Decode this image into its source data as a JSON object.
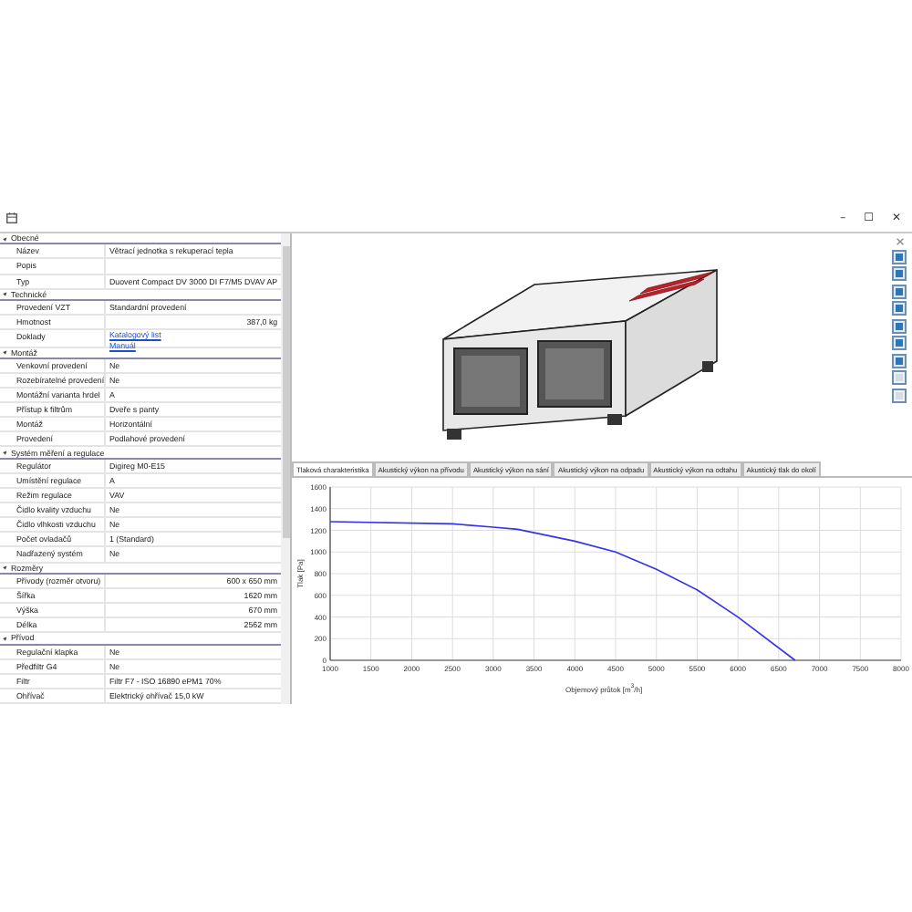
{
  "window": {
    "controls": [
      "–",
      "☐",
      "✕"
    ]
  },
  "properties": [
    {
      "section": "Obecné",
      "expanded": true,
      "rows": [
        {
          "label": "Název",
          "value": "Větrací jednotka s rekuperací tepla"
        },
        {
          "label": "Popis"
        },
        {
          "label": "Typ",
          "value": "Duovent Compact DV 3000 DI F7/M5 DVAV AP"
        }
      ]
    },
    {
      "section": "Technické",
      "expanded": true,
      "rows": [
        {
          "label": "Provedení VZT",
          "value": "Standardní provedení"
        },
        {
          "label": "Hmotnost",
          "value": "387,0 kg",
          "kind": "quantity"
        },
        {
          "label": "Doklady",
          "links": [
            "Katalogový list",
            "Manuál"
          ]
        }
      ]
    },
    {
      "section": "Montáž",
      "expanded": true,
      "rows": [
        {
          "label": "Venkovní provedení",
          "value": "Ne"
        },
        {
          "label": "Rozebíratelné provedení",
          "value": "Ne"
        },
        {
          "label": "Montážní varianta hrdel",
          "value": "A"
        },
        {
          "label": "Přístup k filtrům",
          "value": "Dveře s panty"
        },
        {
          "label": "Montáž",
          "value": "Horizontální"
        },
        {
          "label": "Provedení",
          "value": "Podlahové provedení"
        }
      ]
    },
    {
      "section": "Systém měření a regulace",
      "expanded": true,
      "rows": [
        {
          "label": "Regulátor",
          "value": "Digireg M0-E15"
        },
        {
          "label": "Umístění regulace",
          "value": "A"
        },
        {
          "label": "Režim regulace",
          "value": "VAV"
        },
        {
          "label": "Čidlo kvality vzduchu",
          "value": "Ne"
        },
        {
          "label": "Čidlo vlhkosti vzduchu",
          "value": "Ne"
        },
        {
          "label": "Počet ovladačů",
          "value": "1 (Standard)"
        },
        {
          "label": "Nadřazený systém",
          "value": "Ne"
        }
      ]
    },
    {
      "section": "Rozměry",
      "expanded": true,
      "rows": [
        {
          "label": "Přívody (rozměr otvoru)",
          "value": "600 x 650 mm",
          "kind": "quantity"
        },
        {
          "label": "Šířka",
          "value": "1620 mm",
          "kind": "quantity"
        },
        {
          "label": "Výška",
          "value": "670 mm",
          "kind": "quantity"
        },
        {
          "label": "Délka",
          "value": "2562 mm",
          "kind": "quantity"
        }
      ]
    },
    {
      "section": "Přívod",
      "expanded": true,
      "rows": [
        {
          "label": "Regulační klapka",
          "value": "Ne"
        },
        {
          "label": "Předfiltr G4",
          "value": "Ne"
        },
        {
          "label": "Filtr",
          "value": "Filtr F7 - ISO 16890 ePM1 70%"
        },
        {
          "label": "Ohřívač",
          "value": "Elektrický ohřívač 15,0 kW"
        }
      ]
    }
  ],
  "chart_tabs": [
    {
      "label": "Tlaková charakteristika",
      "selected": true
    },
    {
      "label": "Akustický výkon na přívodu",
      "selected": false
    },
    {
      "label": "Akustický výkon na sání",
      "selected": false
    },
    {
      "label": "Akustický výkon na odpadu",
      "selected": false
    },
    {
      "label": "Akustický výkon na odtahu",
      "selected": false
    },
    {
      "label": "Akustický tlak do okolí",
      "selected": false
    }
  ],
  "chart": {
    "chart_data": {
      "type": "line",
      "xlabel": "Objemový průtok [m$^{3}$/h]",
      "ylabel": "Tlak [Pa]",
      "x": [
        1000,
        2500,
        3000,
        3300,
        4000,
        4500,
        5000,
        5500,
        6000,
        6700
      ],
      "series": [
        {
          "color": "#3333ee",
          "values": [
            1280,
            1260,
            1230,
            1210,
            1100,
            1000,
            840,
            650,
            400,
            0
          ]
        }
      ],
      "grid": true,
      "xlim": [
        1000,
        8000
      ],
      "ylim": [
        0,
        1600
      ],
      "xticks": [
        1000,
        1500,
        2000,
        2500,
        3000,
        3500,
        4000,
        4500,
        5000,
        5500,
        6000,
        6500,
        7000,
        7500,
        8000
      ],
      "yticks": [
        0,
        200,
        400,
        600,
        800,
        1000,
        1200,
        1400,
        1600
      ]
    }
  }
}
